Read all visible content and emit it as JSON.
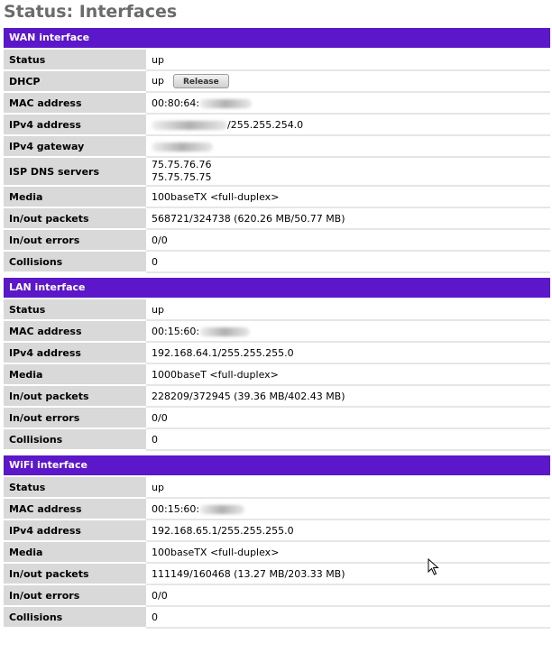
{
  "page": {
    "title": "Status: Interfaces"
  },
  "colors": {
    "header_bg": "#5b17c9",
    "header_text": "#ffffff",
    "label_bg": "#d9d9d9",
    "title_text": "#6b6b6b"
  },
  "wan": {
    "title": "WAN interface",
    "status_label": "Status",
    "status_value": "up",
    "dhcp_label": "DHCP",
    "dhcp_value": "up",
    "release_button": "Release",
    "mac_label": "MAC address",
    "mac_value": "00:80:64:",
    "ipv4_label": "IPv4 address",
    "ipv4_value": "/255.255.254.0",
    "gateway_label": "IPv4 gateway",
    "dns_label": "ISP DNS servers",
    "dns_value_1": "75.75.76.76",
    "dns_value_2": "75.75.75.75",
    "media_label": "Media",
    "media_value": "100baseTX <full-duplex>",
    "packets_label": "In/out packets",
    "packets_value": "568721/324738 (620.26 MB/50.77 MB)",
    "errors_label": "In/out errors",
    "errors_value": "0/0",
    "collisions_label": "Collisions",
    "collisions_value": "0"
  },
  "lan": {
    "title": "LAN interface",
    "status_label": "Status",
    "status_value": "up",
    "mac_label": "MAC address",
    "mac_value": "00:15:60:",
    "ipv4_label": "IPv4 address",
    "ipv4_value": "192.168.64.1/255.255.255.0",
    "media_label": "Media",
    "media_value": "1000baseT <full-duplex>",
    "packets_label": "In/out packets",
    "packets_value": "228209/372945 (39.36 MB/402.43 MB)",
    "errors_label": "In/out errors",
    "errors_value": "0/0",
    "collisions_label": "Collisions",
    "collisions_value": "0"
  },
  "wifi": {
    "title": "WiFi interface",
    "status_label": "Status",
    "status_value": "up",
    "mac_label": "MAC address",
    "mac_value": "00:15:60:",
    "ipv4_label": "IPv4 address",
    "ipv4_value": "192.168.65.1/255.255.255.0",
    "media_label": "Media",
    "media_value": "100baseTX <full-duplex>",
    "packets_label": "In/out packets",
    "packets_value": "111149/160468 (13.27 MB/203.33 MB)",
    "errors_label": "In/out errors",
    "errors_value": "0/0",
    "collisions_label": "Collisions",
    "collisions_value": "0"
  }
}
